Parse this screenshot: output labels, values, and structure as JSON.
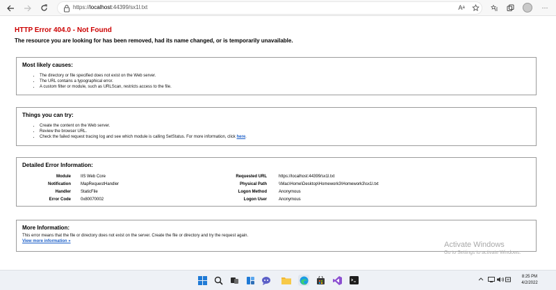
{
  "browser": {
    "url_prefix": "https://",
    "url_host": "localhost",
    "url_rest": ":44399/sx1l.txt"
  },
  "page": {
    "error_title": "HTTP Error 404.0 - Not Found",
    "error_subtitle": "The resource you are looking for has been removed, had its name changed, or is temporarily unavailable."
  },
  "causes": {
    "heading": "Most likely causes:",
    "items": [
      "The directory or file specified does not exist on the Web server.",
      "The URL contains a typographical error.",
      "A custom filter or module, such as URLScan, restricts access to the file."
    ]
  },
  "try": {
    "heading": "Things you can try:",
    "items": [
      "Create the content on the Web server.",
      "Review the browser URL."
    ],
    "item3_text": "Check the failed request tracing log and see which module is calling SetStatus. For more information, click ",
    "item3_link": "here",
    "item3_after": "."
  },
  "details": {
    "heading": "Detailed Error Information:",
    "left": [
      {
        "label": "Module",
        "value": "IIS Web Core"
      },
      {
        "label": "Notification",
        "value": "MapRequestHandler"
      },
      {
        "label": "Handler",
        "value": "StaticFile"
      },
      {
        "label": "Error Code",
        "value": "0x80070002"
      }
    ],
    "right": [
      {
        "label": "Requested URL",
        "value": "https://localhost:44399/sx1l.txt"
      },
      {
        "label": "Physical Path",
        "value": "\\\\Mac\\Home\\Desktop\\Homework3\\Homework3\\sx1l.txt"
      },
      {
        "label": "Logon Method",
        "value": "Anonymous"
      },
      {
        "label": "Logon User",
        "value": "Anonymous"
      }
    ]
  },
  "more": {
    "heading": "More Information:",
    "text": "This error means that the file or directory does not exist on the server. Create the file or directory and try the request again.",
    "link": "View more information »"
  },
  "watermark": {
    "line1": "Activate Windows",
    "line2": "Go to Settings to activate Windows."
  },
  "taskbar": {
    "time": "8:25 PM",
    "date": "4/2/2022",
    "icons": [
      "windows-start-icon",
      "search-icon",
      "task-view-icon",
      "widgets-icon",
      "chat-icon",
      "file-explorer-icon",
      "edge-icon",
      "store-icon",
      "visual-studio-icon",
      "terminal-icon"
    ]
  },
  "colors": {
    "error_red": "#cc0000",
    "link_blue": "#1a5ec8"
  }
}
